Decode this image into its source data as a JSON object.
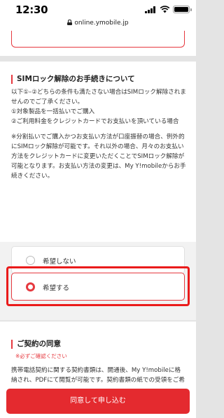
{
  "status_bar": {
    "time": "12:30"
  },
  "browser": {
    "url": "online.ymobile.jp"
  },
  "sim_unlock": {
    "title": "SIMロック解除のお手続きについて",
    "intro": "以下①–②どちらの条件も満たさない場合はSIMロック解除されませんのでご了承ください。",
    "condition_1": "①対象製品を一括払いでご購入",
    "condition_2": "②ご利用料金をクレジットカードでお支払いを頂いている場合",
    "note": "※分割払いでご購入かつお支払い方法が口座振替の場合、例外的にSIMロック解除が可能です。それ以外の場合、月々のお支払い方法をクレジットカードに変更いただくことでSIMロック解除が可能となります。お支払い方法の変更は、My Y!mobileからお手続きください。",
    "options": [
      {
        "label": "希望しない",
        "selected": false
      },
      {
        "label": "希望する",
        "selected": true
      }
    ]
  },
  "contract": {
    "title": "ご契約の同意",
    "required": "※必ずご確認ください",
    "body": "携帯電話契約に関する契約書類は、開通後、My Y!mobileに格納され、PDFにて閲覧が可能です。契約書類の紙での受領をご希望の場合、下記にて「郵送による書面受け取りを希望する」を選択してください。開通後7日以内にご契約住所へ発送いたします。"
  },
  "footer": {
    "submit_label": "同意して申し込む"
  },
  "colors": {
    "accent": "#e6393f",
    "highlight": "#ea1b1b",
    "submit": "#e42a2f"
  }
}
